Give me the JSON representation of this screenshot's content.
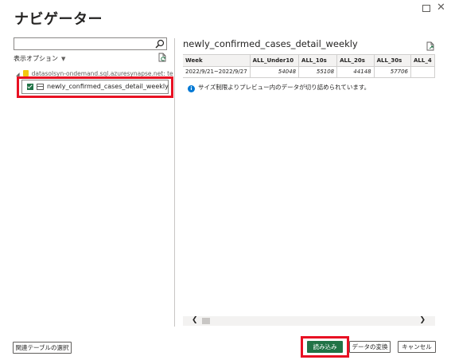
{
  "window": {
    "title": "ナビゲーター",
    "maximize_glyph": "",
    "close_glyph": "✕"
  },
  "navigator": {
    "search": {
      "value": "",
      "placeholder": ""
    },
    "display_options": "表示オプション",
    "display_options_caret": "▼",
    "source": "datasolsyn-ondemand.sql.azuresynapse.net: te",
    "source_arrow": "◢",
    "items": [
      {
        "label": "newly_confirmed_cases_detail_weekly",
        "checked": true
      }
    ]
  },
  "preview": {
    "title": "newly_confirmed_cases_detail_weekly",
    "columns": [
      "Week",
      "ALL_Under10",
      "ALL_10s",
      "ALL_20s",
      "ALL_30s",
      "ALL_4"
    ],
    "rows": [
      [
        "2022/9/21~2022/9/27",
        "54048",
        "55108",
        "44148",
        "57706",
        ""
      ]
    ],
    "notice": "サイズ制限よりプレビュー内のデータが切り詰められています。",
    "notice_icon": "i",
    "scroll_left": "❮",
    "scroll_right": "❯"
  },
  "footer": {
    "related_tables": "関連テーブルの選択",
    "load": "読み込み",
    "transform": "データの変換",
    "cancel": "キャンセル"
  },
  "colors": {
    "accent": "#217346",
    "highlight": "#e81123",
    "info": "#0078d4"
  },
  "icons": [
    "search-icon",
    "refresh-icon",
    "export-icon",
    "info-icon",
    "table-icon",
    "database-icon",
    "close-icon",
    "maximize-icon"
  ]
}
